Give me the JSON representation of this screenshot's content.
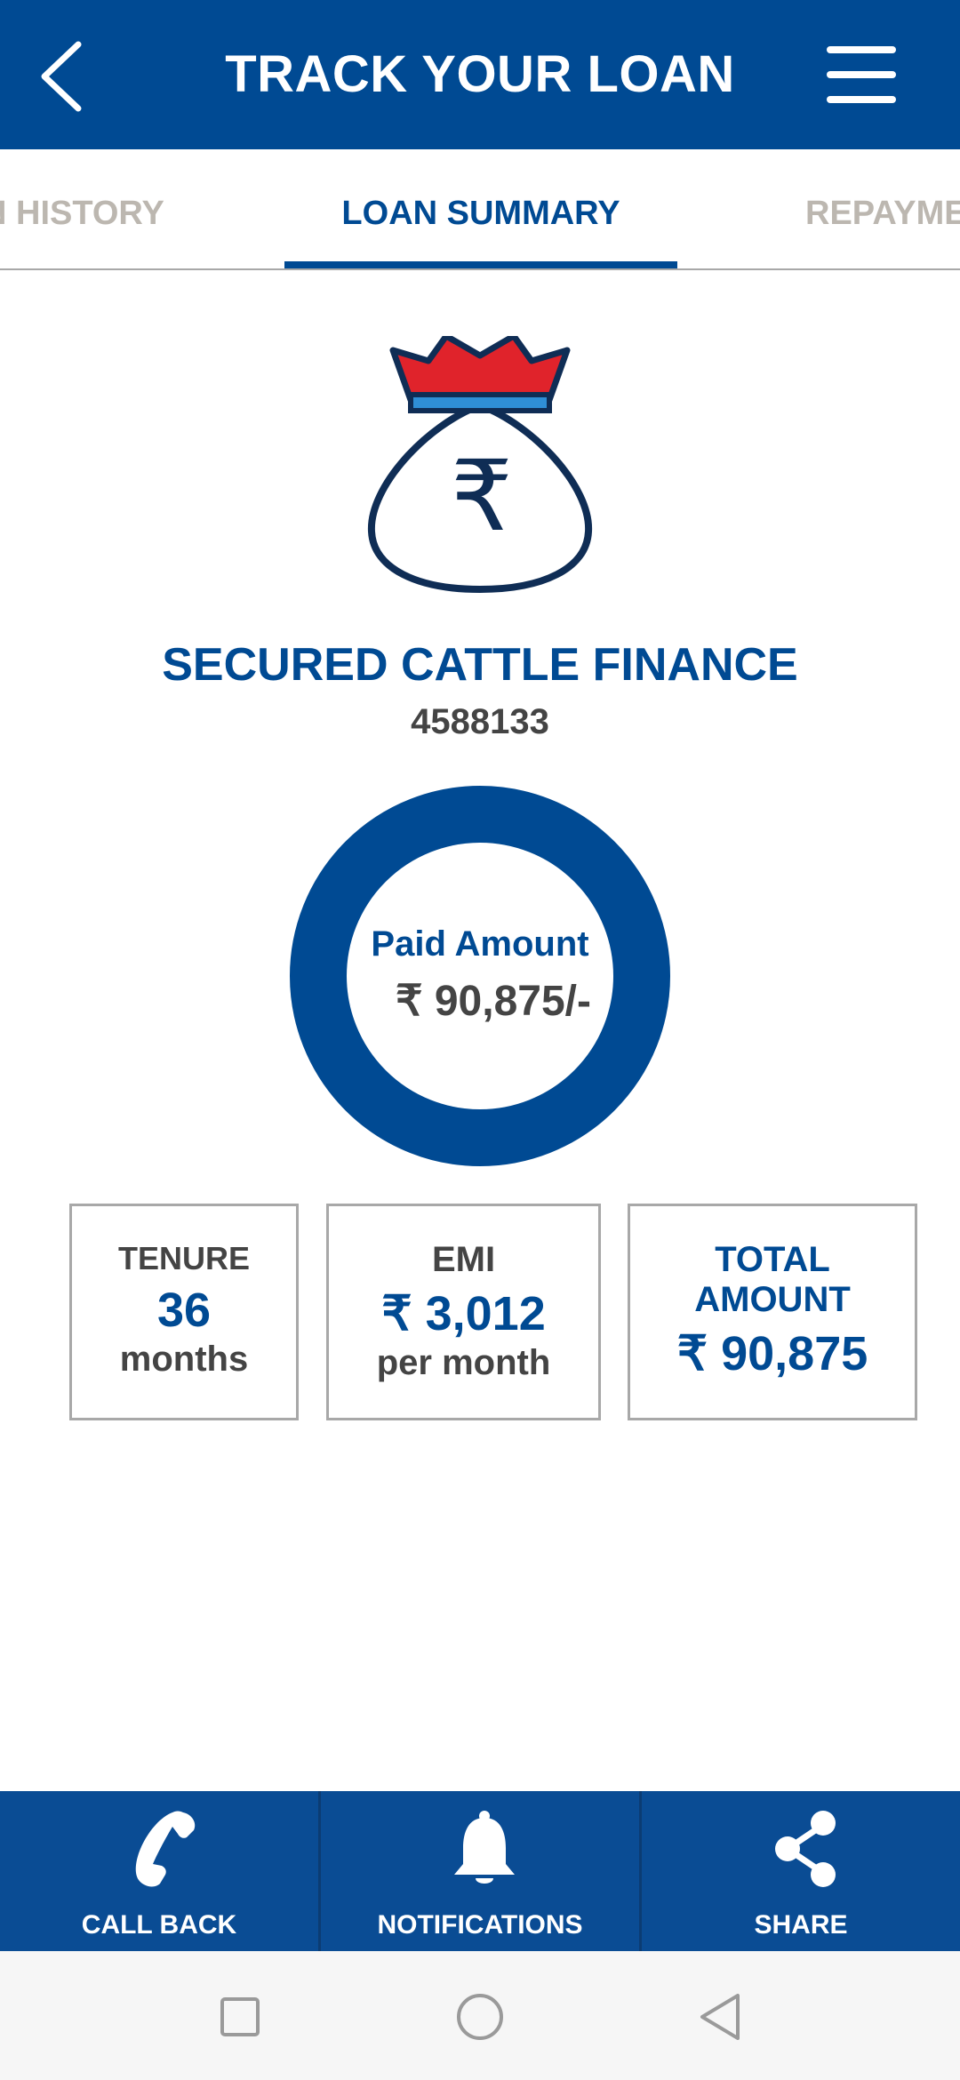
{
  "header": {
    "title": "TRACK YOUR LOAN",
    "back_icon": "chevron-left-icon",
    "menu_icon": "hamburger-menu-icon"
  },
  "tabs": [
    {
      "label": "N HISTORY",
      "active": false
    },
    {
      "label": "LOAN SUMMARY",
      "active": true
    },
    {
      "label": "REPAYMEN",
      "active": false
    }
  ],
  "loan": {
    "icon": "money-bag-icon",
    "name": "SECURED CATTLE FINANCE",
    "number": "4588133",
    "paid_label": "Paid Amount",
    "paid_value": "₹ 90,875/-",
    "paid_fraction": 1.0
  },
  "stats": {
    "tenure": {
      "label": "TENURE",
      "value": "36",
      "unit": "months"
    },
    "emi": {
      "label": "EMI",
      "value": "₹ 3,012",
      "unit": "per month"
    },
    "total": {
      "label_line1": "TOTAL",
      "label_line2": "AMOUNT",
      "value": "₹ 90,875"
    }
  },
  "bottom_nav": [
    {
      "label": "CALL BACK",
      "icon": "phone-icon"
    },
    {
      "label": "NOTIFICATIONS",
      "icon": "bell-icon"
    },
    {
      "label": "SHARE",
      "icon": "share-icon"
    }
  ],
  "system_nav": {
    "recent_icon": "square-icon",
    "home_icon": "circle-icon",
    "back_icon": "triangle-back-icon"
  },
  "colors": {
    "primary": "#004a93",
    "accent_red": "#e0232b",
    "accent_light_blue": "#2f8fd6",
    "text_dark": "#444444",
    "tab_inactive": "#bcb7b0"
  }
}
